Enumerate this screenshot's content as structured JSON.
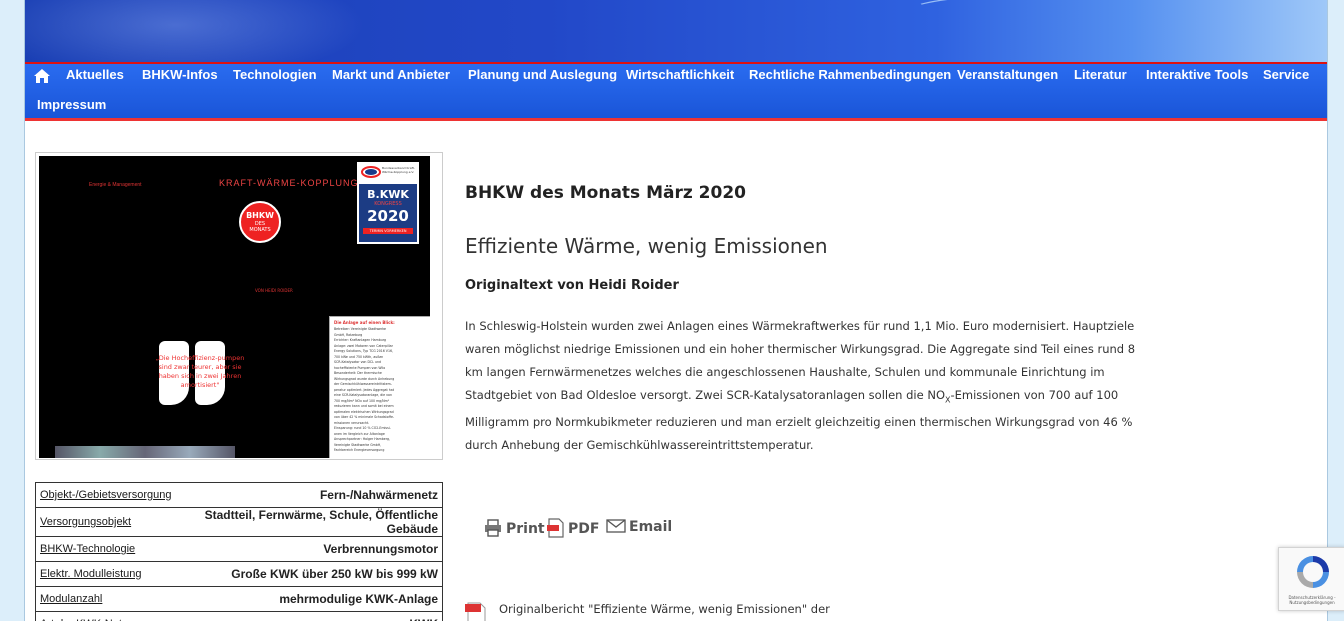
{
  "nav": {
    "home_icon": "home-icon",
    "items": [
      "Aktuelles",
      "BHKW-Infos",
      "Technologien",
      "Markt und Anbieter",
      "Planung und Auslegung",
      "Wirtschaftlichkeit",
      "Rechtliche Rahmenbedingungen",
      "Veranstaltungen",
      "Literatur",
      "Interaktive Tools",
      "Service",
      "Impressum"
    ]
  },
  "magazine": {
    "brand": "Energie & Management",
    "headline": "KRAFT-WÄRME-KOPPLUNG",
    "badge_lines": [
      "BHKW",
      "DES",
      "MONATS"
    ],
    "author_line": "VON HEIDI ROIDER",
    "quote": "„Die Hocheffizienz-pumpen sind zwar teurer, aber sie haben sich in zwei Jahren amortisiert\"",
    "ad_org": "Bundesverband Kraft-Wärme-Kopplung e.V.",
    "ad_title": "B.KWK",
    "ad_sub": "KONGRESS",
    "ad_year": "2020",
    "ad_note": "TERMIN VORMERKEN",
    "box_title": "Die Anlage auf einen Blick:",
    "box_lines": [
      "Betreiber: Vereinigte Stadtwerke",
      "GmbH, Ratzeburg",
      "Errichter: Kraftanlagen Hamburg",
      "Anlage: zwei Motoren von Caterpillar",
      "Energy Solutions, Typ TCG 2016 V16,",
      "700 kWe und 750 kWth, außen",
      "SCR-Katalysator von DCL und",
      "hocheffiziente Pumpen von Wilo",
      "Besonderheit: Der thermische",
      "Wirkungsgrad wurde durch Anhebung",
      "der Gemischkühlwassereintrittstem-",
      "peratur optimiert. Jedes Aggregat hat",
      "eine SCR-Katalysatoranlage, die von",
      "700 mg/Nm³ NOx auf 100 mg/Nm³",
      "reduzieren kann und somit bei einem",
      "optimalen elektrischen Wirkungsgrad",
      "von über 42 % minimale Schadstoffe-",
      "missionen verursacht.",
      "Einsparung: rund 10 % CO2-Emissi-",
      "onen im Vergleich zur Altanlage",
      "Ansprechpartner: Holger Hamberg,",
      "Vereinigte Stadtwerke GmbH,",
      "Fachbereich Energieversorgung"
    ]
  },
  "facts": [
    {
      "label": "Objekt-/Gebietsversorgung",
      "value": "Fern-/Nahwärmenetz"
    },
    {
      "label": "Versorgungsobjekt",
      "value": "Stadtteil, Fernwärme, Schule, Öffentliche Gebäude"
    },
    {
      "label": "BHKW-Technologie",
      "value": "Verbrennungsmotor"
    },
    {
      "label": "Elektr. Modulleistung",
      "value": "Große KWK über 250 kW bis 999 kW"
    },
    {
      "label": "Modulanzahl",
      "value": "mehrmodulige KWK-Anlage"
    },
    {
      "label": "Art der KWK-Nutzung",
      "value": "KWK"
    }
  ],
  "article": {
    "month_title": "BHKW des Monats März 2020",
    "title": "Effiziente Wärme, wenig Emissionen",
    "author": "Originaltext von Heidi Roider",
    "p_before": "In Schleswig-Holstein wurden zwei Anlagen eines Wärmekraftwerkes für rund 1,1 Mio. Euro modernisiert. Hauptziele waren möglichst niedrige Emissionen und ein hoher thermischer Wirkungsgrad. Die Aggregate sind Teil eines rund 8 km langen Fernwärmenetzes welches die angeschlossenen Haushalte, Schulen und kommunale Einrichtung im Stadtgebiet von Bad Oldesloe versorgt. Zwei SCR-Katalysatoranlagen sollen die NO",
    "p_sub": "X",
    "p_after": "-Emissionen von 700 auf 100 Milligramm pro Normkubikmeter reduzieren und man erzielt gleichzeitig einen thermischen Wirkungsgrad von 46 % durch Anhebung der Gemischkühlwassereintrittstemperatur."
  },
  "share": {
    "print": "Print",
    "pdf": "PDF",
    "email": "Email"
  },
  "attachment": {
    "text": "Originalbericht \"Effiziente Wärme, wenig Emissionen\" der"
  },
  "recaptcha": {
    "line1": "Datenschutzerklärung -",
    "line2": "Nutzungsbedingungen"
  },
  "colors": {
    "nav": "#1a55d8",
    "accent_red": "#e33",
    "banner": "#2248c8"
  }
}
